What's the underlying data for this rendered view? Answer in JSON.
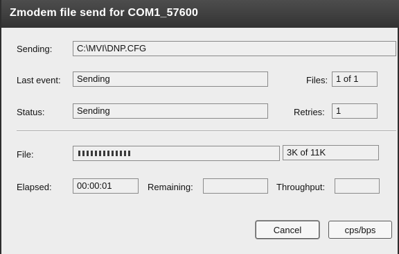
{
  "window": {
    "title": "Zmodem file send for COM1_57600"
  },
  "sending": {
    "label": "Sending:",
    "value": "C:\\MVI\\DNP.CFG"
  },
  "last_event": {
    "label": "Last event:",
    "value": "Sending"
  },
  "files": {
    "label": "Files:",
    "value": "1 of 1"
  },
  "status": {
    "label": "Status:",
    "value": "Sending"
  },
  "retries": {
    "label": "Retries:",
    "value": "1"
  },
  "file": {
    "label": "File:",
    "progress_fraction": 0.27,
    "progress_text": "3K of 11K"
  },
  "elapsed": {
    "label": "Elapsed:",
    "value": "00:00:01"
  },
  "remaining": {
    "label": "Remaining:",
    "value": ""
  },
  "throughput": {
    "label": "Throughput:",
    "value": ""
  },
  "buttons": {
    "cancel": "Cancel",
    "cps": "cps/bps"
  }
}
